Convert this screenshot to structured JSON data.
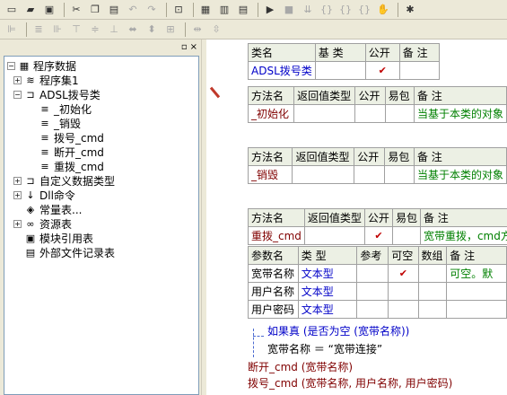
{
  "toolbar1": {
    "icons": [
      "new-file-icon",
      "open-folder-icon",
      "save-icon",
      "cut-icon",
      "copy-icon",
      "paste-icon",
      "undo-icon",
      "redo-icon",
      "find-icon",
      "window-icon",
      "split-h-icon",
      "split-v-icon",
      "run-icon",
      "stop-icon",
      "step-in-icon",
      "step-over-icon",
      "step-out-icon",
      "step-run-icon",
      "hand-icon",
      "debug-icon"
    ]
  },
  "toolbar2": {
    "icons": [
      "align-left-icon",
      "align-center-icon",
      "align-right-icon",
      "align-top-icon",
      "align-middle-icon",
      "align-bottom-icon",
      "same-width-icon",
      "same-height-icon",
      "same-size-icon",
      "h-space-icon",
      "v-space-icon"
    ]
  },
  "pane": {
    "pin": "▫",
    "close": "×"
  },
  "tree": {
    "root": "程序数据",
    "items": [
      {
        "label": "程序集1",
        "level": 1,
        "expander": "+",
        "icon": "≋"
      },
      {
        "label": "ADSL拨号类",
        "level": 1,
        "expander": "−",
        "icon": "⊐"
      },
      {
        "label": "_初始化",
        "level": 2,
        "expander": "",
        "icon": "≡"
      },
      {
        "label": "_销毁",
        "level": 2,
        "expander": "",
        "icon": "≡"
      },
      {
        "label": "拨号_cmd",
        "level": 2,
        "expander": "",
        "icon": "≡"
      },
      {
        "label": "断开_cmd",
        "level": 2,
        "expander": "",
        "icon": "≡"
      },
      {
        "label": "重拨_cmd",
        "level": 2,
        "expander": "",
        "icon": "≡"
      },
      {
        "label": "自定义数据类型",
        "level": 1,
        "expander": "+",
        "icon": "⊐"
      },
      {
        "label": "Dll命令",
        "level": 1,
        "expander": "+",
        "icon": "↓"
      },
      {
        "label": "常量表...",
        "level": 1,
        "expander": "",
        "icon": "◈"
      },
      {
        "label": "资源表",
        "level": 1,
        "expander": "+",
        "icon": "∞"
      },
      {
        "label": "模块引用表",
        "level": 1,
        "expander": "",
        "icon": "▣"
      },
      {
        "label": "外部文件记录表",
        "level": 1,
        "expander": "",
        "icon": "▤"
      }
    ]
  },
  "class_table": {
    "headers": [
      "类名",
      "基 类",
      "公开",
      "备 注"
    ],
    "row": [
      "ADSL拨号类",
      "",
      "✔",
      ""
    ]
  },
  "method1": {
    "headers": [
      "方法名",
      "返回值类型",
      "公开",
      "易包",
      "备 注"
    ],
    "row": [
      "_初始化",
      "",
      "",
      "",
      "当基于本类的对象"
    ]
  },
  "method2": {
    "headers": [
      "方法名",
      "返回值类型",
      "公开",
      "易包",
      "备 注"
    ],
    "row": [
      "_销毁",
      "",
      "",
      "",
      "当基于本类的对象"
    ]
  },
  "method3": {
    "headers": [
      "方法名",
      "返回值类型",
      "公开",
      "易包",
      "备 注"
    ],
    "row": [
      "重拨_cmd",
      "",
      "✔",
      "",
      "宽带重拨，cmd方"
    ]
  },
  "params": {
    "headers": [
      "参数名",
      "类 型",
      "参考",
      "可空",
      "数组",
      "备 注"
    ],
    "rows": [
      [
        "宽带名称",
        "文本型",
        "",
        "✔",
        "",
        "可空。默"
      ],
      [
        "用户名称",
        "文本型",
        "",
        "",
        "",
        ""
      ],
      [
        "用户密码",
        "文本型",
        "",
        "",
        "",
        ""
      ]
    ]
  },
  "code": {
    "line1": "如果真 (是否为空 (宽带名称))",
    "line2": "宽带名称 ＝ “宽带连接”",
    "line3": "断开_cmd (宽带名称)",
    "line4": "拨号_cmd (宽带名称, 用户名称, 用户密码)"
  }
}
